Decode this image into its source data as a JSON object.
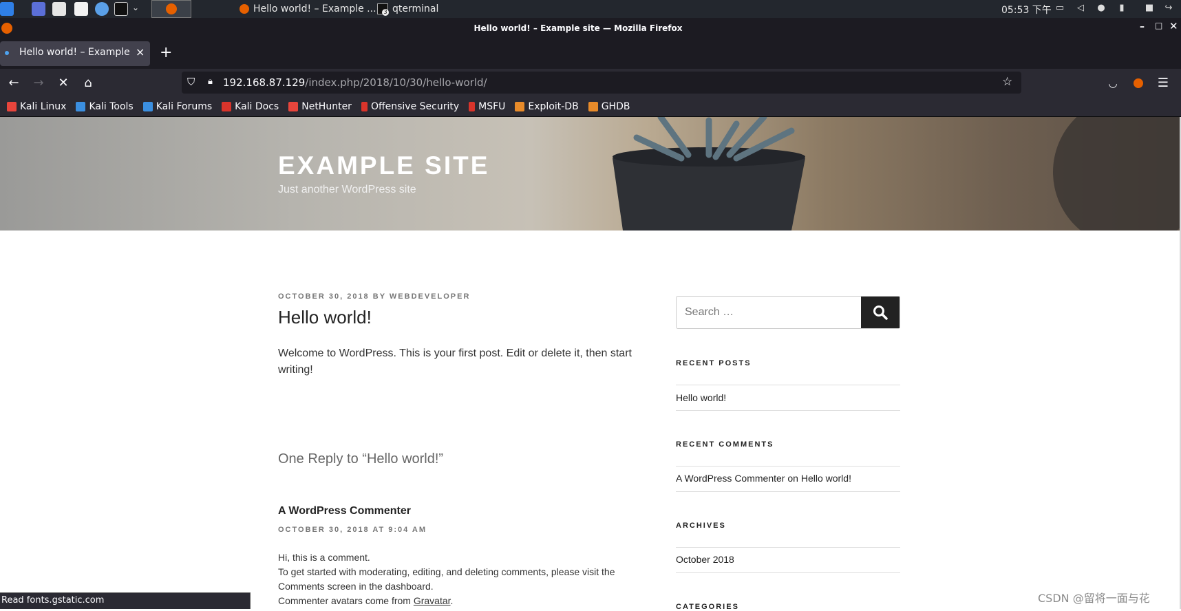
{
  "taskbar": {
    "tasks": [
      {
        "label": "Hello world! – Example ..."
      },
      {
        "label": "qterminal",
        "badge": "3"
      }
    ],
    "clock": "05:53 下午"
  },
  "window": {
    "title": "Hello world! – Example site — Mozilla Firefox"
  },
  "tab": {
    "title": "Hello world! – Example si",
    "close": "×",
    "new": "+"
  },
  "url": {
    "host": "192.168.87.129",
    "path": "/index.php/2018/10/30/hello-world/"
  },
  "bookmarks": [
    {
      "label": "Kali Linux",
      "color": "#e8453c"
    },
    {
      "label": "Kali Tools",
      "color": "#3b8fe0"
    },
    {
      "label": "Kali Forums",
      "color": "#3b8fe0"
    },
    {
      "label": "Kali Docs",
      "color": "#d9342b"
    },
    {
      "label": "NetHunter",
      "color": "#e8453c"
    },
    {
      "label": "Offensive Security",
      "color": "#d9342b"
    },
    {
      "label": "MSFU",
      "color": "#d9342b"
    },
    {
      "label": "Exploit-DB",
      "color": "#e88b2a"
    },
    {
      "label": "GHDB",
      "color": "#e88b2a"
    }
  ],
  "site": {
    "title": "EXAMPLE SITE",
    "description": "Just another WordPress site"
  },
  "post": {
    "date": "OCTOBER 30, 2018",
    "by": "BY",
    "author": "WEBDEVELOPER",
    "title": "Hello world!",
    "content": "Welcome to WordPress. This is your first post. Edit or delete it, then start writing!"
  },
  "comments": {
    "heading": "One Reply to “Hello world!”",
    "author": "A WordPress Commenter",
    "date": "OCTOBER 30, 2018 AT 9:04 AM",
    "line1": "Hi, this is a comment.",
    "line2": "To get started with moderating, editing, and deleting comments, please visit the",
    "line3": "Comments screen in the dashboard.",
    "line4_pre": "Commenter avatars come from ",
    "line4_link": "Gravatar",
    "line4_post": "."
  },
  "sidebar": {
    "search_placeholder": "Search …",
    "recent_posts_title": "RECENT POSTS",
    "recent_post": "Hello world!",
    "recent_comments_title": "RECENT COMMENTS",
    "rc_author": "A WordPress Commenter",
    "rc_on": "on",
    "rc_post": "Hello world!",
    "archives_title": "ARCHIVES",
    "archive": "October 2018",
    "categories_title": "CATEGORIES"
  },
  "status": {
    "text": "Read fonts.gstatic.com"
  },
  "watermark": "CSDN @留将一面与花"
}
